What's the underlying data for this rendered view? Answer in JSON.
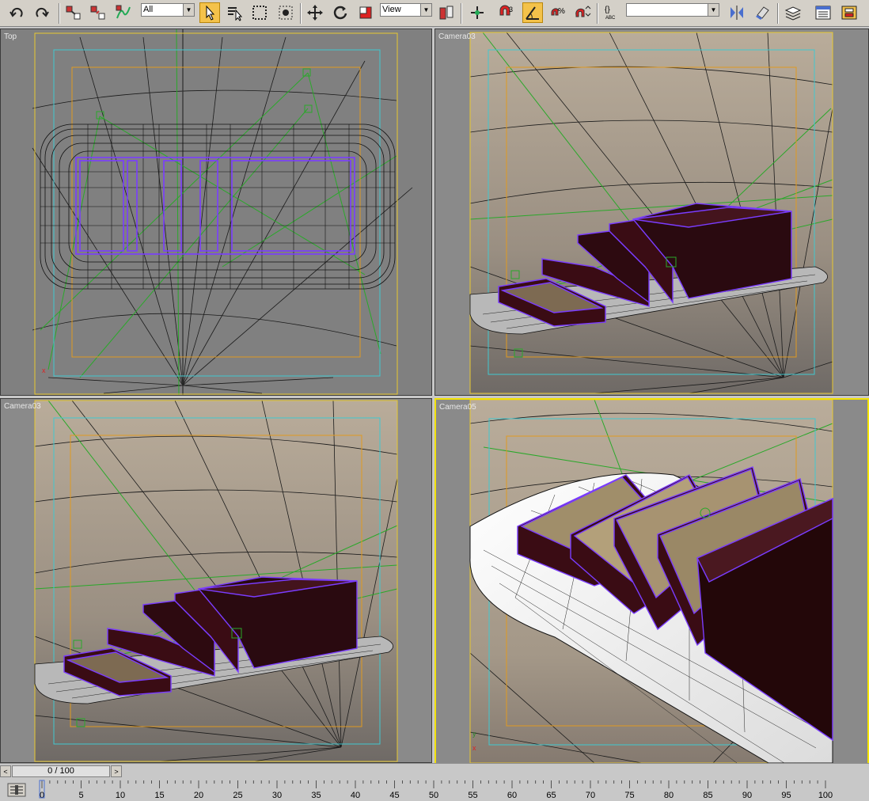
{
  "toolbar": {
    "selection_filter": "All",
    "reference_coord_system": "View",
    "named_selection_set": "",
    "snap_label": "3",
    "buttons": [
      {
        "name": "undo-icon"
      },
      {
        "name": "redo-icon"
      },
      {
        "name": "select-and-link-icon"
      },
      {
        "name": "unlink-selection-icon"
      },
      {
        "name": "bind-to-space-warp-icon"
      },
      {
        "name": "select-object-icon"
      },
      {
        "name": "select-by-name-icon"
      },
      {
        "name": "rectangular-selection-region-icon"
      },
      {
        "name": "window-crossing-icon"
      },
      {
        "name": "select-and-move-icon"
      },
      {
        "name": "select-and-rotate-icon"
      },
      {
        "name": "select-and-scale-icon"
      },
      {
        "name": "use-pivot-center-icon"
      },
      {
        "name": "select-and-manipulate-icon"
      },
      {
        "name": "snaps-toggle-icon"
      },
      {
        "name": "angle-snap-icon"
      },
      {
        "name": "percent-snap-icon"
      },
      {
        "name": "spinner-snap-icon"
      },
      {
        "name": "edit-named-selection-icon"
      },
      {
        "name": "mirror-icon"
      },
      {
        "name": "align-icon"
      },
      {
        "name": "layer-manager-icon"
      },
      {
        "name": "curve-editor-icon"
      },
      {
        "name": "schematic-view-icon"
      }
    ]
  },
  "viewports": [
    {
      "id": "top-left",
      "label": "Top",
      "active": false
    },
    {
      "id": "top-right",
      "label": "Camera03",
      "active": false
    },
    {
      "id": "bottom-left",
      "label": "Camera03",
      "active": false
    },
    {
      "id": "bottom-right",
      "label": "Camera05",
      "active": true
    }
  ],
  "timeslider": {
    "frame_text": "0 / 100",
    "prev_glyph": "<",
    "next_glyph": ">"
  },
  "trackbar": {
    "ticks": [
      "0",
      "5",
      "10",
      "15",
      "20",
      "25",
      "30",
      "35",
      "40",
      "45",
      "50",
      "55",
      "60",
      "65",
      "70",
      "75",
      "80",
      "85",
      "90",
      "95",
      "100"
    ]
  },
  "colors": {
    "active_viewport_border": "#f2e200",
    "toolbar_active": "#f4c24a",
    "safe_frame_outer": "#e8c830",
    "safe_frame_action": "#40c8d0",
    "safe_frame_title": "#e09a20",
    "camera_line": "#2aa82a",
    "selection_wire": "#7a3cff",
    "cake_dark": "#3a0c14"
  }
}
